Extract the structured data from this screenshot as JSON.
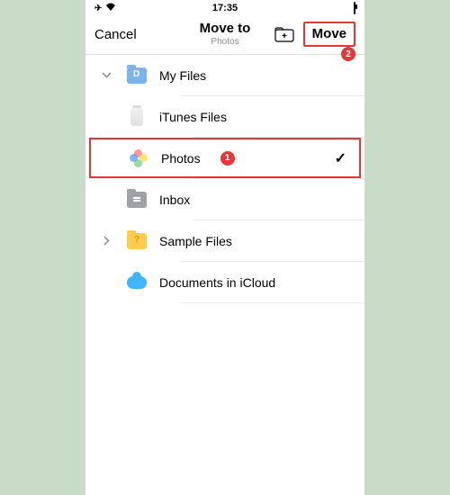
{
  "status": {
    "time": "17:35"
  },
  "nav": {
    "cancel": "Cancel",
    "title": "Move to",
    "subtitle": "Photos",
    "move": "Move"
  },
  "annotations": {
    "badge1": "1",
    "badge2": "2"
  },
  "rows": {
    "myfiles": {
      "label": "My Files"
    },
    "itunes": {
      "label": "iTunes Files"
    },
    "photos": {
      "label": "Photos"
    },
    "inbox": {
      "label": "Inbox"
    },
    "sample": {
      "label": "Sample Files"
    },
    "icloud": {
      "label": "Documents in iCloud"
    }
  }
}
